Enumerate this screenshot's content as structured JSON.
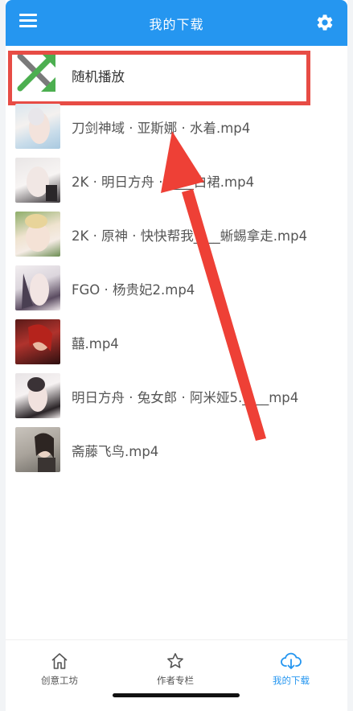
{
  "appbar": {
    "title": "我的下载",
    "menu_icon": "hamburger-menu-icon",
    "settings_icon": "gear-icon"
  },
  "random_play": {
    "label": "随机播放",
    "icon": "shuffle-icon"
  },
  "videos": [
    {
      "title": "刀剑神域 · 亚斯娜 · 水着.mp4"
    },
    {
      "title": "2K · 明日方舟 · ____白裙.mp4"
    },
    {
      "title": "2K · 原神 · 快快帮我____蜥蜴拿走.mp4"
    },
    {
      "title": "FGO · 杨贵妃2.mp4"
    },
    {
      "title": "囍.mp4"
    },
    {
      "title": "明日方舟 · 兔女郎 · 阿米娅5.____mp4"
    },
    {
      "title": "斋藤飞鸟.mp4"
    }
  ],
  "bottom_nav": [
    {
      "label": "创意工坊",
      "icon": "home-icon",
      "active": false
    },
    {
      "label": "作者专栏",
      "icon": "star-icon",
      "active": false
    },
    {
      "label": "我的下载",
      "icon": "cloud-download-icon",
      "active": true
    }
  ],
  "colors": {
    "accent": "#2596f0",
    "highlight": "#e74c45"
  }
}
